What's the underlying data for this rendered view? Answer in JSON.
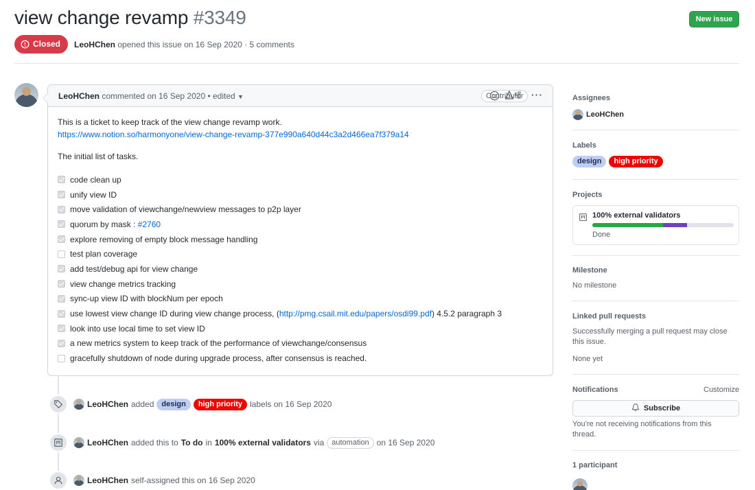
{
  "header": {
    "title": "view change revamp",
    "number": "#3349",
    "new_issue_label": "New issue",
    "state_label": "Closed",
    "author": "LeoHChen",
    "meta_text": "opened this issue on 16 Sep 2020 · 5 comments"
  },
  "comment": {
    "author": "LeoHChen",
    "meta": "commented on 16 Sep 2020 • edited",
    "role_badge": "Contributor",
    "icons": [
      "smiley-icon",
      "report-icon",
      "kebab-menu-icon"
    ],
    "body_line1": "This is a ticket to keep track of the view change revamp work.",
    "body_link": "https://www.notion.so/harmonyone/view-change-revamp-377e990a640d44c3a2d466ea7f379a14",
    "body_line2": "The initial list of tasks.",
    "tasks": [
      {
        "text": "code clean up",
        "checked": true
      },
      {
        "text": "unify view ID",
        "checked": true
      },
      {
        "text": "move validation of viewchange/newview messages to p2p layer",
        "checked": true
      },
      {
        "text": "quorum by mask : ",
        "link": "#2760",
        "checked": true
      },
      {
        "text": "explore removing of empty block message handling",
        "checked": true
      },
      {
        "text": "test plan coverage",
        "checked": false
      },
      {
        "text": "add test/debug api for view change",
        "checked": true
      },
      {
        "text": "view change metrics tracking",
        "checked": true
      },
      {
        "text": "sync-up view ID with blockNum per epoch",
        "checked": true
      },
      {
        "text": "use lowest view change ID during view change process, (",
        "link": "http://pmg.csail.mit.edu/papers/osdi99.pdf",
        "suffix": ") 4.5.2 paragraph 3",
        "checked": true
      },
      {
        "text": "look into use local time to set view ID",
        "checked": true
      },
      {
        "text": "a new metrics system to keep track of the performance of viewchange/consensus",
        "checked": true
      },
      {
        "text": "gracefully shutdown of node during upgrade process, after consensus is reached.",
        "checked": false
      }
    ]
  },
  "events": {
    "labels": {
      "author": "LeoHChen",
      "verb": "added",
      "label1": "design",
      "label2": "high priority",
      "suffix": "labels on 16 Sep 2020"
    },
    "project": {
      "author": "LeoHChen",
      "verb": "added this to",
      "column": "To do",
      "in": "in",
      "project": "100% external validators",
      "via": "via",
      "automation": "automation",
      "suffix": "on 16 Sep 2020"
    },
    "assign": {
      "author": "LeoHChen",
      "suffix": "self-assigned this on 16 Sep 2020"
    }
  },
  "sidebar": {
    "assignees_title": "Assignees",
    "assignee": "LeoHChen",
    "labels_title": "Labels",
    "labels": [
      "design",
      "high priority"
    ],
    "projects_title": "Projects",
    "project_name": "100% external validators",
    "project_status": "Done",
    "project_progress": {
      "done": 0.5,
      "in_progress": 0.17
    },
    "milestone_title": "Milestone",
    "milestone_value": "No milestone",
    "linked_prs_title": "Linked pull requests",
    "linked_prs_text": "Successfully merging a pull request may close this issue.",
    "linked_prs_value": "None yet",
    "notifications_title": "Notifications",
    "customize_label": "Customize",
    "subscribe_label": "Subscribe",
    "notifications_text": "You’re not receiving notifications from this thread.",
    "participants_title": "1 participant"
  },
  "colors": {
    "closed": "#d73a49",
    "new_issue": "#2ea44f",
    "label_design": "#bfcdf2",
    "label_high_priority": "#ee0701",
    "progress_done": "#28a745",
    "progress_in_progress": "#6f42c1"
  }
}
